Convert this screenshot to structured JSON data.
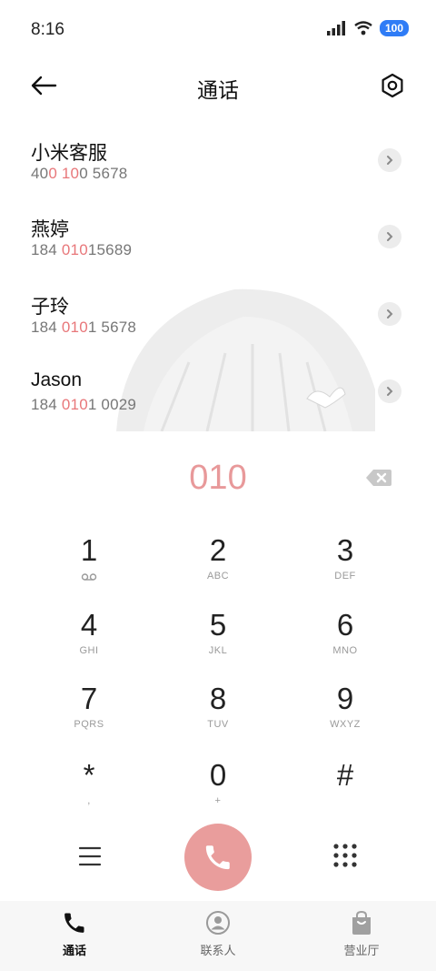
{
  "status": {
    "time": "8:16",
    "battery": "100"
  },
  "header": {
    "title": "通话"
  },
  "contacts": [
    {
      "name": "小米客服",
      "num_pre": "40",
      "num_hl1": "0",
      "num_mid": " ",
      "num_hl2": "10",
      "num_post": "0 5678"
    },
    {
      "name": "燕婷",
      "num_pre": "184 ",
      "num_hl1": "010",
      "num_mid": "",
      "num_hl2": "",
      "num_post": "15689"
    },
    {
      "name": "子玲",
      "num_pre": "184 ",
      "num_hl1": "010",
      "num_mid": "",
      "num_hl2": "",
      "num_post": "1 5678"
    },
    {
      "name": "Jason",
      "num_pre": "184 ",
      "num_hl1": "010",
      "num_mid": "",
      "num_hl2": "",
      "num_post": "1 0029"
    }
  ],
  "dialer": {
    "input": "010"
  },
  "keys": [
    {
      "d": "1",
      "s": "voicemail-icon"
    },
    {
      "d": "2",
      "s": "ABC"
    },
    {
      "d": "3",
      "s": "DEF"
    },
    {
      "d": "4",
      "s": "GHI"
    },
    {
      "d": "5",
      "s": "JKL"
    },
    {
      "d": "6",
      "s": "MNO"
    },
    {
      "d": "7",
      "s": "PQRS"
    },
    {
      "d": "8",
      "s": "TUV"
    },
    {
      "d": "9",
      "s": "WXYZ"
    },
    {
      "d": "*",
      "s": ","
    },
    {
      "d": "0",
      "s": "+"
    },
    {
      "d": "#",
      "s": ""
    }
  ],
  "tabs": [
    {
      "label": "通话"
    },
    {
      "label": "联系人"
    },
    {
      "label": "营业厅"
    }
  ],
  "colors": {
    "accent": "#e8777a",
    "call": "#e99d9c"
  }
}
